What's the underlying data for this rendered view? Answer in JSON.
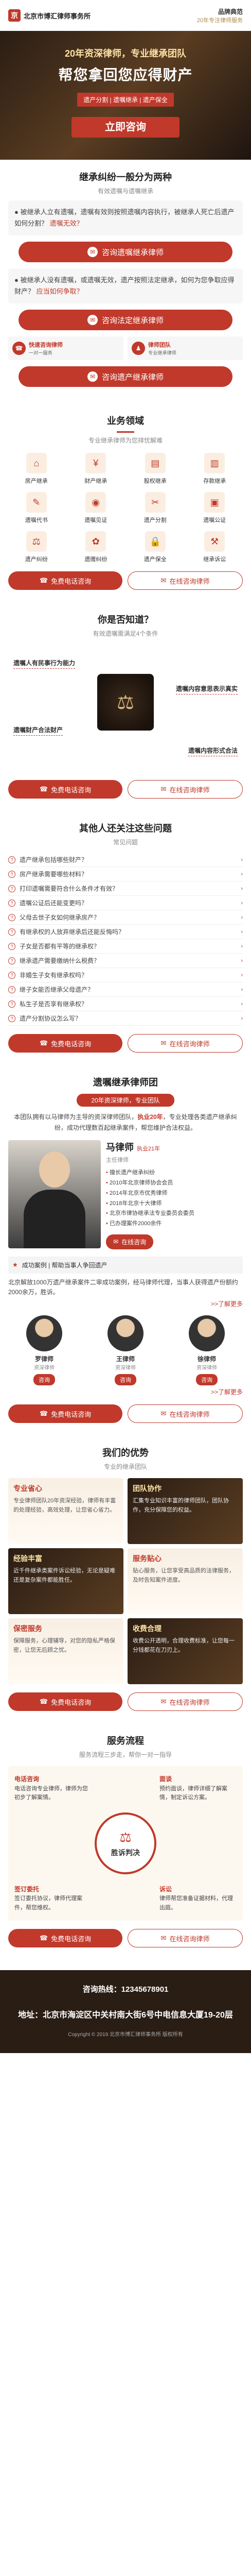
{
  "header": {
    "logo_mark": "京",
    "logo_text": "北京市博汇律师事务所",
    "tagline_1": "品牌典范",
    "tagline_2": "20年专注律师服务"
  },
  "hero": {
    "subtitle": "20年资深律师，专业继承团队",
    "title": "帮您拿回您应得财产",
    "tags": "遗产分割 | 遗嘱继承 | 遗产保全",
    "cta": "立即咨询"
  },
  "inherit": {
    "title": "继承纠纷一般分为两种",
    "subtitle": "有效遗嘱与遗嘱继承",
    "box1": "被继承人立有遗嘱，遗嘱有效则按照遗嘱内容执行，被继承人死亡后遗产如何分割？",
    "box2": "被继承人没有遗嘱，或遗嘱无效，遗产按照法定继承，如何为您争取应得财产？",
    "box1_q": "遗嘱无效？",
    "box2_q": "应当如何争取？",
    "btn1": "咨询遗嘱继承律师",
    "btn2": "咨询法定继承律师",
    "pair1_title": "快速咨询律师",
    "pair1_sub": "一对一服务",
    "pair2_title": "律师团队",
    "pair2_sub": "专业继承律师",
    "btn3": "咨询遗产继承律师"
  },
  "business": {
    "title": "业务领域",
    "subtitle": "专业继承律师为您排忧解难",
    "items": [
      {
        "label": "房产继承",
        "icon": "house-icon"
      },
      {
        "label": "财产继承",
        "icon": "money-icon"
      },
      {
        "label": "股权继承",
        "icon": "chart-icon"
      },
      {
        "label": "存款继承",
        "icon": "bank-icon"
      },
      {
        "label": "遗嘱代书",
        "icon": "pen-icon"
      },
      {
        "label": "遗嘱见证",
        "icon": "seal-icon"
      },
      {
        "label": "遗产分割",
        "icon": "split-icon"
      },
      {
        "label": "遗嘱公证",
        "icon": "stamp-icon"
      },
      {
        "label": "遗产纠纷",
        "icon": "scale-icon"
      },
      {
        "label": "遗赠纠纷",
        "icon": "gift-icon"
      },
      {
        "label": "遗产保全",
        "icon": "lock-icon"
      },
      {
        "label": "继承诉讼",
        "icon": "gavel-icon"
      }
    ],
    "btn_phone": "免费电话咨询",
    "btn_chat": "在线咨询律师"
  },
  "know": {
    "title": "你是否知道？",
    "subtitle": "有效遗嘱需满足4个条件",
    "labels": [
      "遗嘱人有民事行为能力",
      "遗嘱内容意思表示真实",
      "遗嘱财产合法财产",
      "遗嘱内容形式合法"
    ],
    "btn_phone": "免费电话咨询",
    "btn_chat": "在线咨询律师"
  },
  "faq": {
    "title": "其他人还关注这些问题",
    "subtitle": "常见问题",
    "items": [
      "遗产继承包括哪些财产？",
      "房产继承需要哪些材料？",
      "打印遗嘱需要符合什么条件才有效？",
      "遗嘱公证后还能变更吗？",
      "父母去世子女如何继承房产？",
      "有继承权的人放弃继承后还能反悔吗？",
      "子女是否都有平等的继承权？",
      "继承遗产需要缴纳什么税费？",
      "非婚生子女有继承权吗？",
      "继子女能否继承父母遗产？",
      "私生子是否享有继承权？",
      "遗产分割协议怎么写？"
    ],
    "btn_phone": "免费电话咨询",
    "btn_chat": "在线咨询律师"
  },
  "team": {
    "title": "遗嘱继承律师团",
    "pill": "20年资深律师，专业团队",
    "intro_1": "本团队拥有以马律师为主导的资深律师团队，",
    "intro_hl": "执业20年",
    "intro_2": "，专业处理各类遗产继承纠纷，成功代理数百起继承案件，帮您维护合法权益。",
    "lawyer_name": "马律师",
    "lawyer_years": "执业21年",
    "lawyer_title": "主任律师",
    "bullets": [
      "擅长遗产继承纠纷",
      "2010年北京律师协会会员",
      "2014年北京市优秀律师",
      "2018年北京十大律师",
      "北京市律协继承法专业委员会委员",
      "已办理案件2000余件"
    ],
    "online_btn": "在线咨询",
    "case_bar": "成功案例 | 帮助当事人争回遗产",
    "case_text": "北京解放1000万遗产继承案件二审成功案例，经马律师代理，当事人获得遗产份额约2000余万，胜诉。",
    "more": ">>了解更多",
    "lawyers": [
      {
        "name": "罗律师",
        "role": "资深律师",
        "btn": "咨询"
      },
      {
        "name": "王律师",
        "role": "资深律师",
        "btn": "咨询"
      },
      {
        "name": "徐律师",
        "role": "资深律师",
        "btn": "咨询"
      }
    ],
    "more2": ">>了解更多",
    "btn_phone": "免费电话咨询",
    "btn_chat": "在线咨询律师"
  },
  "advantages": {
    "title": "我们的优势",
    "subtitle": "专业的继承团队",
    "items": [
      {
        "title": "专业省心",
        "text": "专业律师团队20年资深经验，律师有丰富的处理经验，高效处理，让您省心省力。"
      },
      {
        "title": "团队协作",
        "text": "汇集专业知识丰富的律师团队，团队协作，充分保障您的权益。"
      },
      {
        "title": "经验丰富",
        "text": "近千件继承类案件诉讼经验，无论是疑难还是复杂案件都能胜任。"
      },
      {
        "title": "服务贴心",
        "text": "贴心服务，让您享受高品质的法律服务，及时告知案件进度。"
      },
      {
        "title": "保密服务",
        "text": "保障服务，心理辅导，对您的隐私严格保密，让您无后顾之忧。"
      },
      {
        "title": "收费合理",
        "text": "收费公开透明，合理收费标准，让您每一分钱都花在刀刃上。"
      }
    ],
    "btn_phone": "免费电话咨询",
    "btn_chat": "在线咨询律师"
  },
  "flow": {
    "title": "服务流程",
    "subtitle": "服务流程三步走，帮你一对一指导",
    "center": "胜诉判决",
    "steps": [
      {
        "title": "电话咨询",
        "text": "电话咨询专业律师，律师为您初步了解案情。"
      },
      {
        "title": "面谈",
        "text": "预约面谈，律师详细了解案情，制定诉讼方案。"
      },
      {
        "title": "签订委托",
        "text": "签订委托协议，律师代理案件，帮您维权。"
      },
      {
        "title": "诉讼",
        "text": "律师帮您准备证据材料，代理出庭。"
      }
    ],
    "btn_phone": "免费电话咨询",
    "btn_chat": "在线咨询律师"
  },
  "footer": {
    "hotline": "咨询热线：12345678901",
    "address": "地址：北京市海淀区中关村南大街6号中电信息大厦19-20层",
    "copyright": "Copyright © 2019 北京市博汇律师事务所 版权所有"
  },
  "colors": {
    "accent": "#c0392b",
    "gold": "#fde2a5",
    "dark": "#2a1d14"
  }
}
